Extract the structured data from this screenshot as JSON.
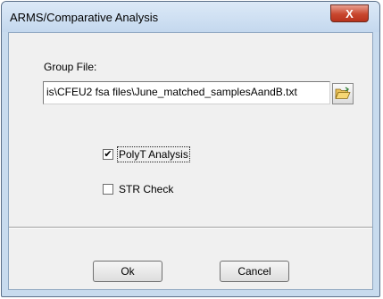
{
  "window": {
    "title": "ARMS/Comparative Analysis",
    "close_label": "X"
  },
  "group_file": {
    "label": "Group File:",
    "value": "is\\CFEU2 fsa files\\June_matched_samplesAandB.txt",
    "browse_icon": "folder-open-icon"
  },
  "options": {
    "polyt": {
      "label": "PolyT Analysis",
      "checked": true,
      "mark": "✔"
    },
    "str": {
      "label": "STR Check",
      "checked": false
    }
  },
  "buttons": {
    "ok": "Ok",
    "cancel": "Cancel"
  }
}
